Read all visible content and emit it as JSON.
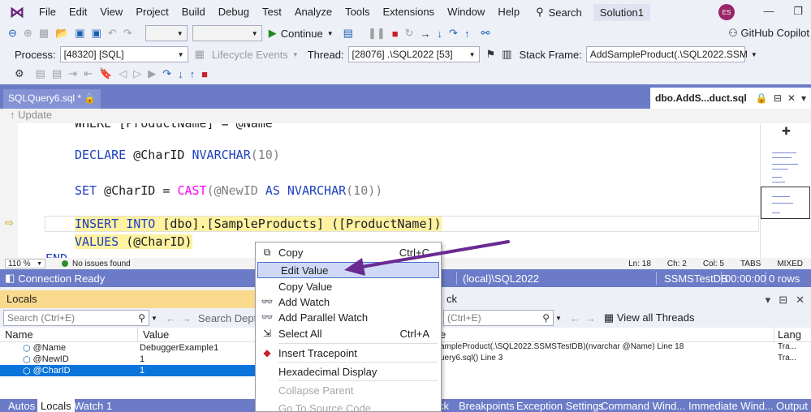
{
  "menubar": {
    "items": [
      "File",
      "Edit",
      "View",
      "Project",
      "Build",
      "Debug",
      "Test",
      "Analyze",
      "Tools",
      "Extensions",
      "Window",
      "Help"
    ],
    "search_label": "Search",
    "solution": "Solution1",
    "avatar_initials": "ES"
  },
  "toolbar1": {
    "continue_label": "Continue",
    "copilot_label": "GitHub Copilot"
  },
  "toolbar2": {
    "process_label": "Process:",
    "process_value": "[48320] [SQL]",
    "lifecycle_label": "Lifecycle Events",
    "thread_label": "Thread:",
    "thread_value": "[28076] .\\SQL2022 [53]",
    "stackframe_label": "Stack Frame:",
    "stackframe_value": "AddSampleProduct(.\\SQL2022.SSM"
  },
  "tabs": {
    "left_tab": "SQLQuery6.sql *",
    "right_tab": "dbo.AddS...duct.sql"
  },
  "update_label": "Update",
  "code": {
    "line0": "WHERE [ProductName] = @Name",
    "line1_kw": "DECLARE",
    "line1_var": " @CharID ",
    "line1_type": "NVARCHAR",
    "line1_rest": "(10)",
    "line2_kw": "SET",
    "line2_mid": " @CharID = ",
    "line2_fn": "CAST",
    "line2_a": "(@NewID ",
    "line2_as": "AS",
    "line2_type": " NVARCHAR",
    "line2_end": "(10))",
    "line3_a": "INSERT INTO",
    "line3_b": " [dbo].[SampleProducts] ([ProductName])",
    "line4_a": "VALUES",
    "line4_b": " (@CharID)",
    "line5": "END"
  },
  "editor_status": {
    "zoom": "110 %",
    "issues": "No issues found",
    "ln": "Ln: 18",
    "ch": "Ch: 2",
    "col": "Col: 5",
    "tabs": "TABS",
    "mixed": "MIXED"
  },
  "connection": {
    "status": "Connection Ready",
    "server": "(local)\\SQL2022",
    "db": "SSMSTestDB",
    "time": "00:00:00",
    "rows": "0 rows"
  },
  "locals": {
    "title": "Locals",
    "search_placeholder": "Search (Ctrl+E)",
    "depth_label": "Search Depth:",
    "col_name": "Name",
    "col_value": "Value",
    "rows": [
      {
        "name": "@Name",
        "value": "DebuggerExample1"
      },
      {
        "name": "@NewID",
        "value": "1"
      },
      {
        "name": "@CharID",
        "value": "1"
      }
    ]
  },
  "stack": {
    "title": "ck",
    "search_placeholder": "(Ctrl+E)",
    "view_threads": "View all Threads",
    "col_name": "e",
    "col_lang": "Lang",
    "rows": [
      {
        "name": "ampleProduct(.\\SQL2022.SSMSTestDB)(nvarchar @Name) Line 18",
        "lang": "Tra..."
      },
      {
        "name": "uery6.sql() Line 3",
        "lang": "Tra..."
      }
    ]
  },
  "bottom_tabs": [
    "Autos",
    "Locals",
    "Watch 1",
    "ck",
    "Breakpoints",
    "Exception Settings",
    "Command Wind...",
    "Immediate Wind...",
    "Output"
  ],
  "context_menu": {
    "items": [
      {
        "label": "Copy",
        "shortcut": "Ctrl+C"
      },
      {
        "label": "Edit Value",
        "shortcut": ""
      },
      {
        "label": "Copy Value",
        "shortcut": ""
      },
      {
        "label": "Add Watch",
        "shortcut": ""
      },
      {
        "label": "Add Parallel Watch",
        "shortcut": ""
      },
      {
        "label": "Select All",
        "shortcut": "Ctrl+A"
      },
      {
        "label": "Insert Tracepoint",
        "shortcut": ""
      },
      {
        "label": "Hexadecimal Display",
        "shortcut": ""
      },
      {
        "label": "Collapse Parent",
        "shortcut": ""
      },
      {
        "label": "Go To Source Code",
        "shortcut": ""
      }
    ]
  },
  "colors": {
    "accent": "#6b7bc7",
    "annotation_arrow": "#6a2a92",
    "selection": "#0a74da",
    "locals_title": "#f9d98c"
  }
}
